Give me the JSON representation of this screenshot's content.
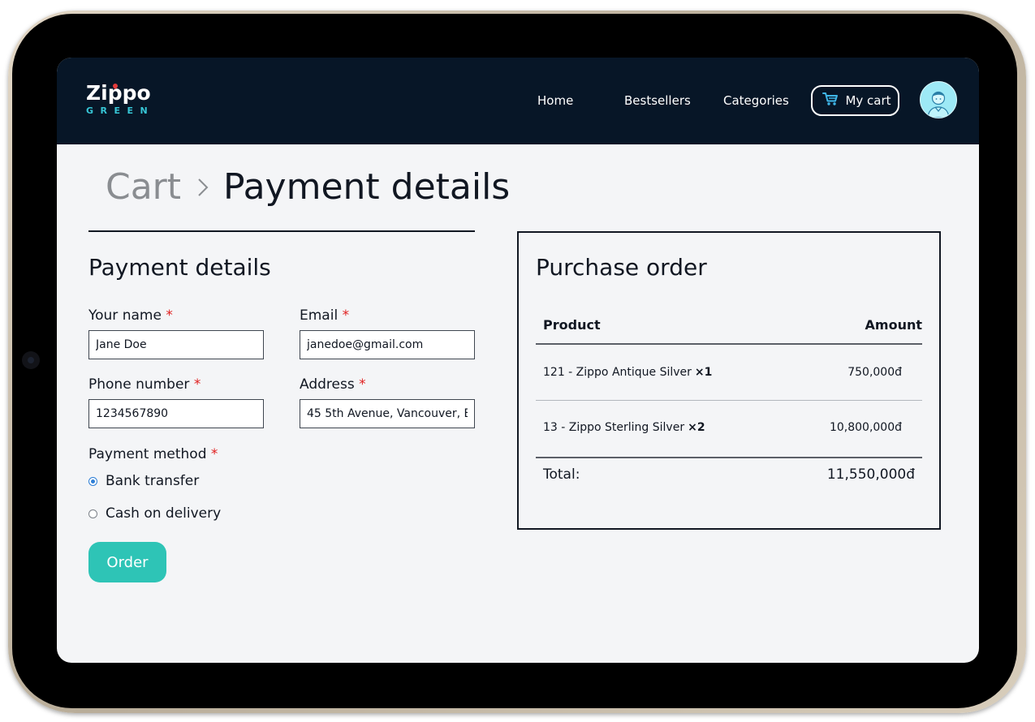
{
  "brand": {
    "name": "Zippo",
    "subtitle": "GREEN"
  },
  "nav": {
    "home": "Home",
    "bestsellers": "Bestsellers",
    "categories": "Categories",
    "cart": "My cart"
  },
  "breadcrumb": {
    "parent": "Cart",
    "current": "Payment details"
  },
  "form": {
    "title": "Payment details",
    "required_mark": "*",
    "name_label": "Your name",
    "name_value": "Jane Doe",
    "email_label": "Email",
    "email_value": "janedoe@gmail.com",
    "phone_label": "Phone number",
    "phone_value": "1234567890",
    "address_label": "Address",
    "address_value": "45 5th Avenue, Vancouver, B",
    "payment_label": "Payment method",
    "payment_options": [
      {
        "label": "Bank transfer",
        "selected": true
      },
      {
        "label": "Cash on delivery",
        "selected": false
      }
    ],
    "order_button": "Order"
  },
  "order": {
    "title": "Purchase order",
    "col_product": "Product",
    "col_amount": "Amount",
    "items": [
      {
        "product": "121 - Zippo Antique Silver",
        "qty": "×1",
        "amount": "750,000đ"
      },
      {
        "product": "13 - Zippo Sterling Silver",
        "qty": "×2",
        "amount": "10,800,000đ"
      }
    ],
    "total_label": "Total:",
    "total_value": "11,550,000đ"
  },
  "colors": {
    "navbar": "#071627",
    "accent": "#2ec4b6",
    "brand_sub": "#37c6d6",
    "required": "#e02020",
    "radio_selected": "#2f7fd6"
  },
  "icons": {
    "cart": "cart-icon",
    "breadcrumb_separator": "chevron-right-icon",
    "avatar": "user-avatar-icon"
  }
}
